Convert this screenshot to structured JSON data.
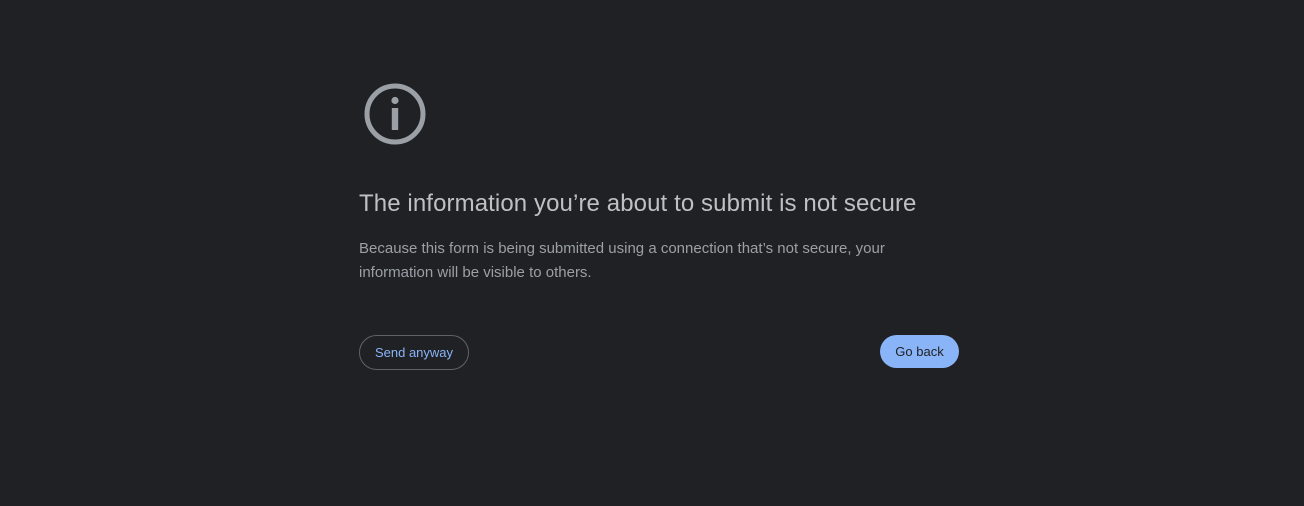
{
  "interstitial": {
    "icon": "info-icon",
    "heading": "The information you’re about to submit is not secure",
    "body": "Because this form is being submitted using a connection that’s not secure, your information will be visible to others.",
    "send_anyway_label": "Send anyway",
    "go_back_label": "Go back"
  },
  "colors": {
    "background": "#202124",
    "heading": "#bdc1c6",
    "body_text": "#9aa0a6",
    "icon": "#9aa0a6",
    "primary_button": "#8ab4f8",
    "link_text": "#8ab4f8"
  }
}
